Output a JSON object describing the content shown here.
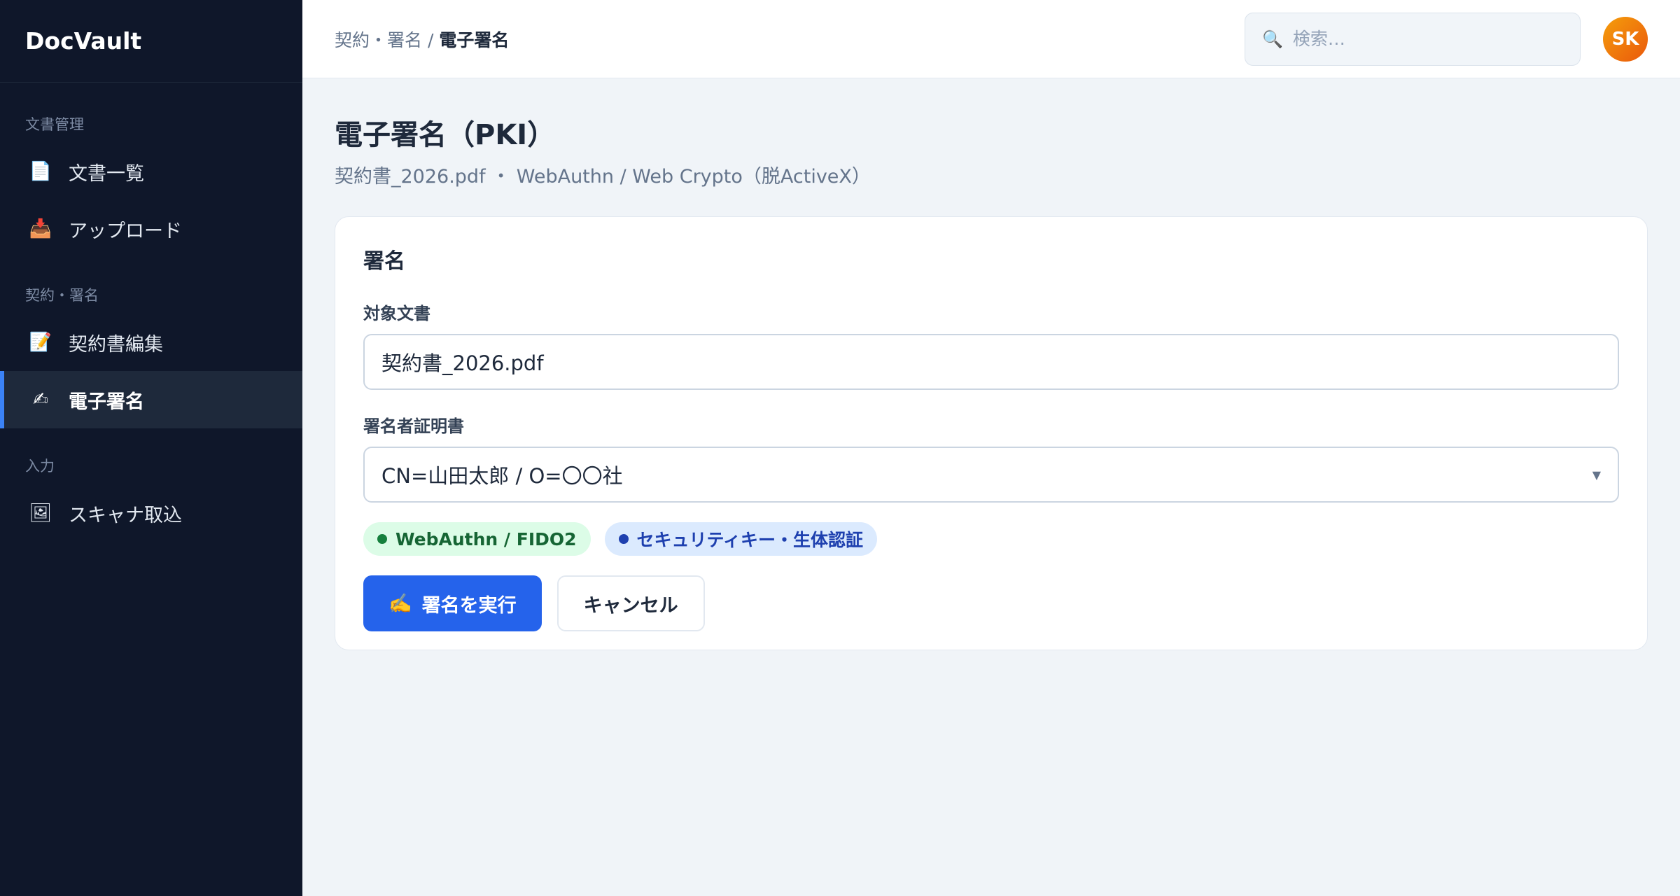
{
  "app": {
    "name": "DocVault"
  },
  "sidebar": {
    "sections": [
      {
        "label": "文書管理",
        "items": [
          {
            "label": "文書一覧",
            "icon": "document-icon"
          },
          {
            "label": "アップロード",
            "icon": "inbox-tray-icon"
          }
        ]
      },
      {
        "label": "契約・署名",
        "items": [
          {
            "label": "契約書編集",
            "icon": "edit-document-icon"
          },
          {
            "label": "電子署名",
            "icon": "writing-hand-icon",
            "active": true
          }
        ]
      },
      {
        "label": "入力",
        "items": [
          {
            "label": "スキャナ取込",
            "icon": "picture-icon"
          }
        ]
      }
    ]
  },
  "header": {
    "breadcrumb_parent": "契約・署名",
    "breadcrumb_separator": "/",
    "breadcrumb_current": "電子署名",
    "search_placeholder": "検索…",
    "avatar_initials": "SK"
  },
  "page": {
    "title": "電子署名（PKI）",
    "subtitle": "契約書_2026.pdf ・ WebAuthn / Web Crypto（脱ActiveX）"
  },
  "sign_card": {
    "title": "署名",
    "target_label": "対象文書",
    "target_value": "契約書_2026.pdf",
    "cert_label": "署名者証明書",
    "cert_value": "CN=山田太郎 / O=〇〇社",
    "badges": [
      {
        "label": "WebAuthn / FIDO2",
        "color": "#15803d"
      },
      {
        "label": "セキュリティキー・生体認証",
        "color": "#1e40af"
      }
    ],
    "primary_icon": "✍",
    "primary_label": "署名を実行",
    "cancel_label": "キャンセル"
  },
  "colors": {
    "sidebar_bg": "#0f172a",
    "accent": "#2563eb",
    "page_bg": "#f0f4f8"
  }
}
